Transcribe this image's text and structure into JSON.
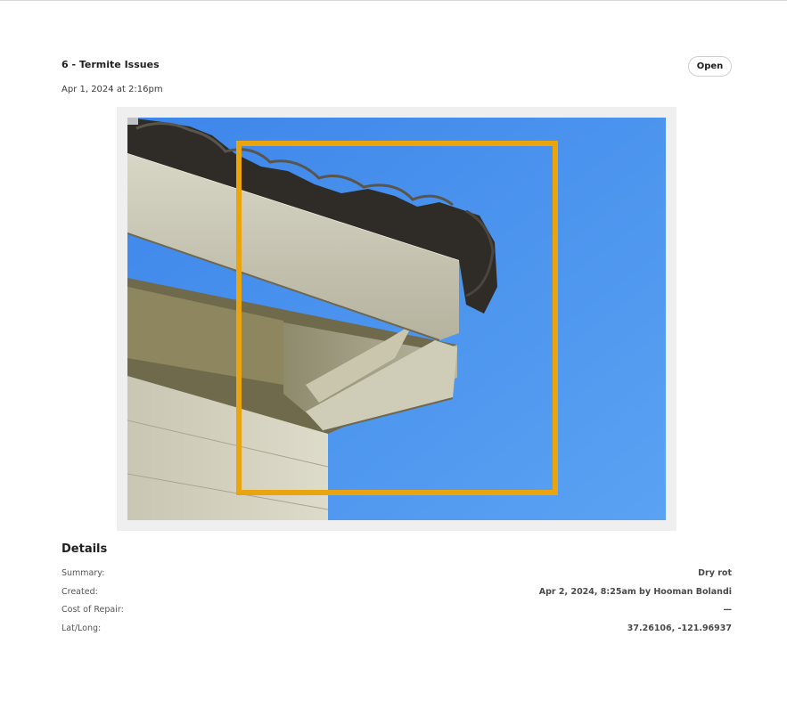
{
  "issue": {
    "title": "6 - Termite Issues",
    "status": "Open",
    "date": "Apr 1, 2024 at 2:16pm"
  },
  "photo": {
    "icon": "photo-of-roof-eave-with-dry-rot",
    "annotation_color": "#E9A40E",
    "sky_color": "#4A90E8"
  },
  "details": {
    "heading": "Details",
    "rows": [
      {
        "label": "Summary:",
        "value": "Dry rot"
      },
      {
        "label": "Created:",
        "value": "Apr 2, 2024, 8:25am by Hooman Bolandi"
      },
      {
        "label": "Cost of Repair:",
        "value": "—"
      },
      {
        "label": "Lat/Long:",
        "value": "37.26106, -121.96937"
      }
    ]
  }
}
